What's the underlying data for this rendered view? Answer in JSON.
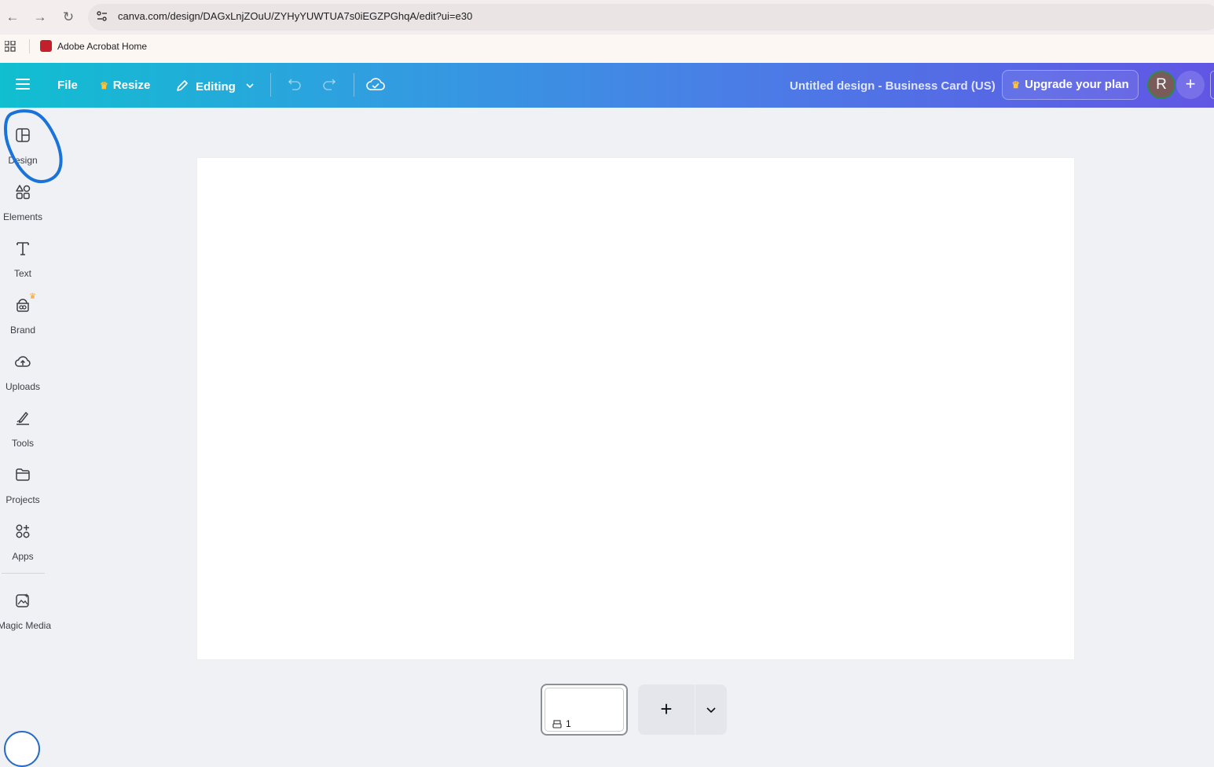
{
  "browser": {
    "url": "canva.com/design/DAGxLnjZOuU/ZYHyYUWTUA7s0iEGZPGhqA/edit?ui=e30",
    "bookmark_label": "Adobe Acrobat Home"
  },
  "header": {
    "file_label": "File",
    "resize_label": "Resize",
    "editing_label": "Editing",
    "doc_title": "Untitled design - Business Card (US)",
    "upgrade_label": "Upgrade your plan",
    "avatar_initial": "R",
    "plus_label": "+"
  },
  "sidebar": {
    "items": [
      {
        "label": "Design",
        "icon": "design-icon"
      },
      {
        "label": "Elements",
        "icon": "elements-icon"
      },
      {
        "label": "Text",
        "icon": "text-icon"
      },
      {
        "label": "Brand",
        "icon": "brand-icon"
      },
      {
        "label": "Uploads",
        "icon": "uploads-icon"
      },
      {
        "label": "Tools",
        "icon": "tools-icon"
      },
      {
        "label": "Projects",
        "icon": "projects-icon"
      },
      {
        "label": "Apps",
        "icon": "apps-icon"
      },
      {
        "label": "Magic Media",
        "icon": "magic-media-icon"
      }
    ]
  },
  "pages": {
    "current_page": "1",
    "add_page_label": "+"
  },
  "colors": {
    "annotation_stroke": "#1a73d9",
    "premium_crown": "#ffc53d"
  }
}
